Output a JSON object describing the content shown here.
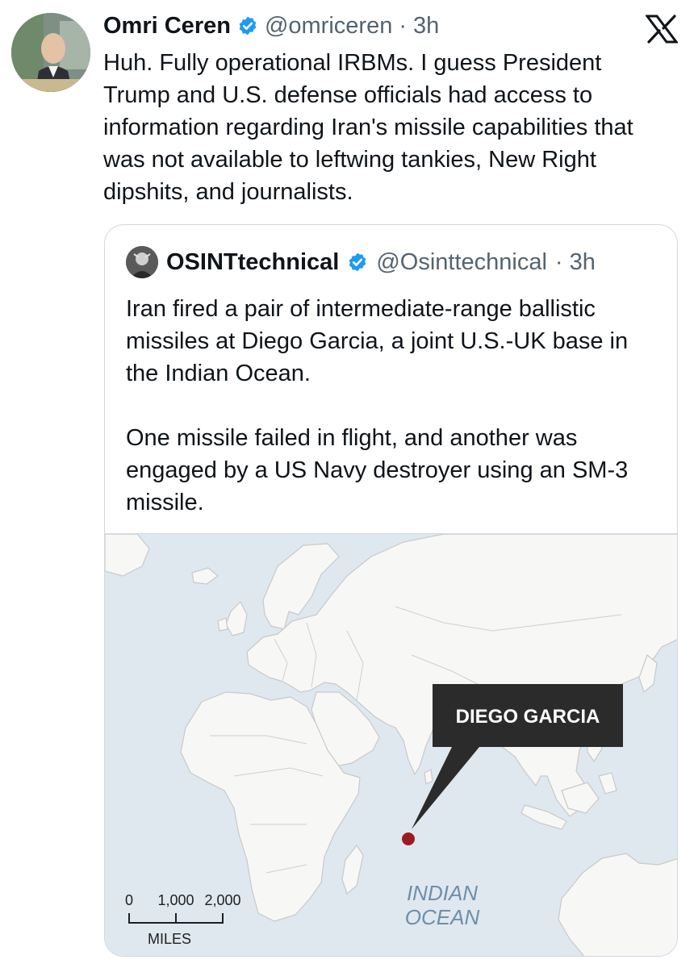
{
  "tweet": {
    "author_name": "Omri Ceren",
    "author_handle": "@omriceren",
    "time": "· 3h",
    "text": "Huh. Fully operational IRBMs. I guess President Trump and U.S. defense officials had access to information regarding Iran's missile capabilities that was not available to leftwing tankies, New Right dipshits, and journalists."
  },
  "quote": {
    "author_name": "OSINTtechnical",
    "author_handle": "@Osinttechnical",
    "time": "· 3h",
    "paragraph_1": "Iran fired a pair of intermediate-range ballistic missiles at Diego Garcia, a joint U.S.-UK base in the Indian Ocean.",
    "paragraph_2": "One missile failed in flight, and another was engaged by a US Navy destroyer using an SM-3 missile."
  },
  "map": {
    "callout_label": "DIEGO GARCIA",
    "ocean_label_line1": "INDIAN",
    "ocean_label_line2": "OCEAN",
    "scale_ticks": [
      "0",
      "1,000",
      "2,000"
    ],
    "scale_unit": "MILES"
  },
  "colors": {
    "text": "#0f1419",
    "secondary_text": "#536471",
    "verified_blue": "#1d9bf0",
    "ocean": "#dfe8ef",
    "land": "#f7f7f6",
    "callout_bg": "#2b2b2b",
    "marker": "#9a1c22",
    "ocean_label": "#6f8fa8"
  },
  "icons": {
    "verified": "verified-badge-icon",
    "x_logo": "x-logo-icon"
  }
}
